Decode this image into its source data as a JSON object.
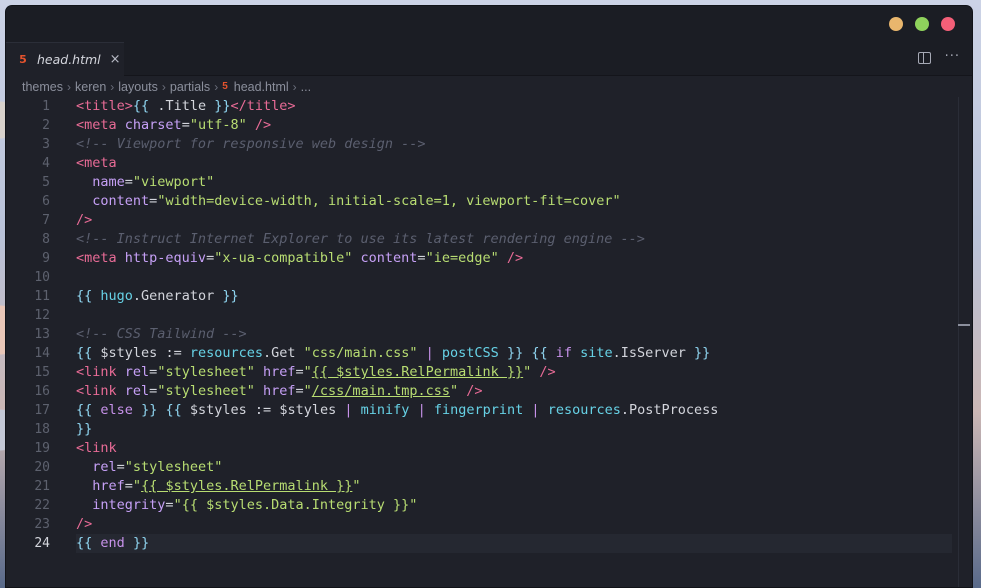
{
  "window": {
    "controls": [
      "minimize",
      "maximize",
      "close"
    ]
  },
  "tab": {
    "label": "head.html",
    "icon": "html5-icon",
    "close": "×"
  },
  "tab_actions": {
    "split": "split-editor-icon",
    "more": "···"
  },
  "breadcrumb": [
    "themes",
    "keren",
    "layouts",
    "partials",
    "head.html",
    "..."
  ],
  "line_numbers": [
    "1",
    "2",
    "3",
    "4",
    "5",
    "6",
    "7",
    "8",
    "9",
    "10",
    "11",
    "12",
    "13",
    "14",
    "15",
    "16",
    "17",
    "18",
    "19",
    "20",
    "21",
    "22",
    "23",
    "24"
  ],
  "active_line": "24",
  "code_lines": [
    "<title>{{ .Title }}</title>",
    "<meta charset=\"utf-8\" />",
    "<!-- Viewport for responsive web design -->",
    "<meta",
    "  name=\"viewport\"",
    "  content=\"width=device-width, initial-scale=1, viewport-fit=cover\"",
    "/>",
    "<!-- Instruct Internet Explorer to use its latest rendering engine -->",
    "<meta http-equiv=\"x-ua-compatible\" content=\"ie=edge\" />",
    "",
    "{{ hugo.Generator }}",
    "",
    "<!-- CSS Tailwind -->",
    "{{ $styles := resources.Get \"css/main.css\" | postCSS }} {{ if site.IsServer }}",
    "<link rel=\"stylesheet\" href=\"{{ $styles.RelPermalink }}\" />",
    "<link rel=\"stylesheet\" href=\"/css/main.tmp.css\" />",
    "{{ else }} {{ $styles := $styles | minify | fingerprint | resources.PostProcess",
    "}}",
    "<link",
    "  rel=\"stylesheet\"",
    "  href=\"{{ $styles.RelPermalink }}\"",
    "  integrity=\"{{ $styles.Data.Integrity }}\"",
    "/>",
    "{{ end }}"
  ],
  "colors": {
    "tag": "#e86b96",
    "attr": "#c6a0f6",
    "string": "#b8dd72",
    "comment": "#5b5f6f",
    "template": "#8fd5f0",
    "background": "#1f2129"
  }
}
